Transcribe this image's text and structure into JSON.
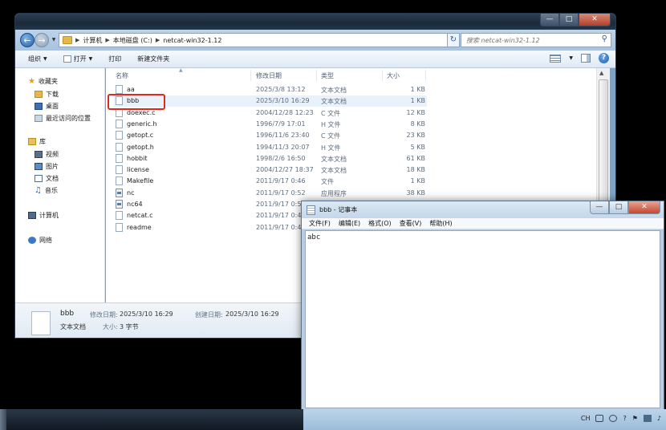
{
  "explorer": {
    "breadcrumb": [
      "计算机",
      "本地磁盘 (C:)",
      "netcat-win32-1.12"
    ],
    "search_placeholder": "搜索 netcat-win32-1.12",
    "toolbar": {
      "organize": "组织",
      "open": "打开",
      "print": "打印",
      "new_folder": "新建文件夹"
    },
    "nav": {
      "favorites": "收藏夹",
      "downloads": "下载",
      "desktop": "桌面",
      "recent": "最近访问的位置",
      "libraries": "库",
      "videos": "视频",
      "pictures": "图片",
      "documents": "文档",
      "music": "音乐",
      "computer": "计算机",
      "network": "网络"
    },
    "columns": {
      "name": "名称",
      "date": "修改日期",
      "type": "类型",
      "size": "大小"
    },
    "files": [
      {
        "name": "aa",
        "date": "2025/3/8 13:12",
        "type": "文本文档",
        "size": "1 KB",
        "icon": "text"
      },
      {
        "name": "bbb",
        "date": "2025/3/10 16:29",
        "type": "文本文档",
        "size": "1 KB",
        "icon": "text"
      },
      {
        "name": "doexec.c",
        "date": "2004/12/28 12:23",
        "type": "C 文件",
        "size": "12 KB",
        "icon": "text"
      },
      {
        "name": "generic.h",
        "date": "1996/7/9 17:01",
        "type": "H 文件",
        "size": "8 KB",
        "icon": "text"
      },
      {
        "name": "getopt.c",
        "date": "1996/11/6 23:40",
        "type": "C 文件",
        "size": "23 KB",
        "icon": "text"
      },
      {
        "name": "getopt.h",
        "date": "1994/11/3 20:07",
        "type": "H 文件",
        "size": "5 KB",
        "icon": "text"
      },
      {
        "name": "hobbit",
        "date": "1998/2/6 16:50",
        "type": "文本文档",
        "size": "61 KB",
        "icon": "text"
      },
      {
        "name": "license",
        "date": "2004/12/27 18:37",
        "type": "文本文档",
        "size": "18 KB",
        "icon": "text"
      },
      {
        "name": "Makefile",
        "date": "2011/9/17 0:46",
        "type": "文件",
        "size": "1 KB",
        "icon": "text"
      },
      {
        "name": "nc",
        "date": "2011/9/17 0:52",
        "type": "应用程序",
        "size": "38 KB",
        "icon": "exe"
      },
      {
        "name": "nc64",
        "date": "2011/9/17 0:5",
        "type": "",
        "size": "",
        "icon": "exe"
      },
      {
        "name": "netcat.c",
        "date": "2011/9/17 0:4",
        "type": "",
        "size": "",
        "icon": "text"
      },
      {
        "name": "readme",
        "date": "2011/9/17 0:4",
        "type": "",
        "size": "",
        "icon": "text"
      }
    ],
    "details": {
      "name": "bbb",
      "type": "文本文档",
      "modified_label": "修改日期:",
      "modified": "2025/3/10 16:29",
      "created_label": "创建日期:",
      "created": "2025/3/10 16:29",
      "size_label": "大小:",
      "size": "3 字节"
    }
  },
  "notepad": {
    "title": "bbb - 记事本",
    "menu": [
      "文件(F)",
      "编辑(E)",
      "格式(O)",
      "查看(V)",
      "帮助(H)"
    ],
    "content": "abc"
  },
  "taskbar": {
    "lang": "CH"
  },
  "colors": {
    "selection_outline": "#e0281f",
    "window_frame": "#7fa2c4"
  }
}
